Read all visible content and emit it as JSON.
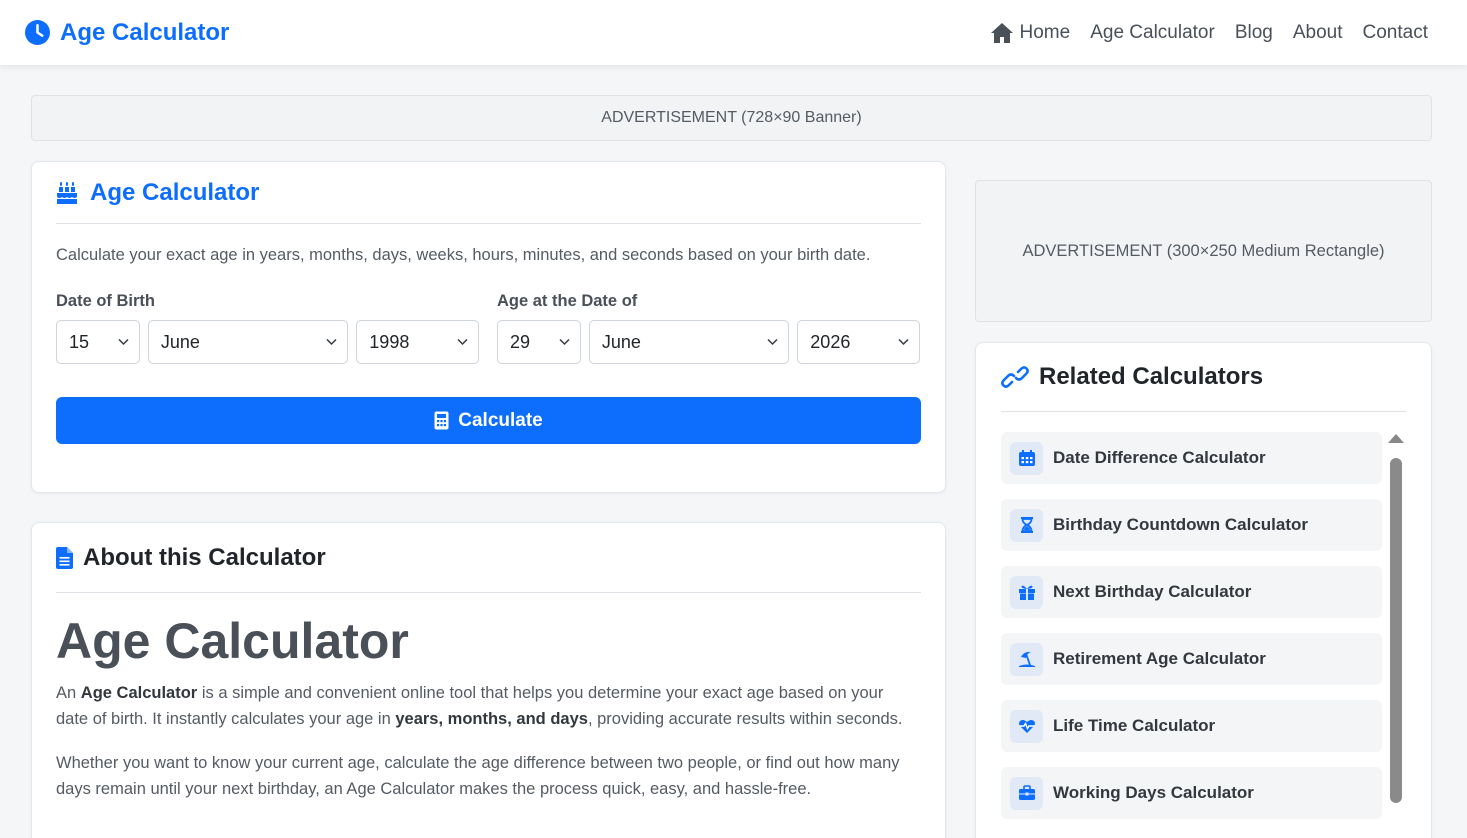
{
  "nav": {
    "brand": "Age Calculator",
    "links": [
      "Home",
      "Age Calculator",
      "Blog",
      "About",
      "Contact"
    ]
  },
  "ads": {
    "banner": "ADVERTISEMENT (728×90 Banner)",
    "rectangle": "ADVERTISEMENT (300×250 Medium Rectangle)"
  },
  "calculator": {
    "title": "Age Calculator",
    "description": "Calculate your exact age in years, months, days, weeks, hours, minutes, and seconds based on your birth date.",
    "dob": {
      "label": "Date of Birth",
      "day": "15",
      "month": "June",
      "year": "1998"
    },
    "target": {
      "label": "Age at the Date of",
      "day": "29",
      "month": "June",
      "year": "2026"
    },
    "button": "Calculate"
  },
  "about": {
    "header": "About this Calculator",
    "title": "Age Calculator",
    "p1": {
      "a": "An ",
      "b": "Age Calculator",
      "c": " is a simple and convenient online tool that helps you determine your exact age based on your date of birth. It instantly calculates your age in ",
      "d": "years, months, and days",
      "e": ", providing accurate results within seconds."
    },
    "p2": "Whether you want to know your current age, calculate the age difference between two people, or find out how many days remain until your next birthday, an Age Calculator makes the process quick, easy, and hassle-free."
  },
  "related": {
    "title": "Related Calculators",
    "items": [
      {
        "label": "Date Difference Calculator",
        "icon": "calendar-icon"
      },
      {
        "label": "Birthday Countdown Calculator",
        "icon": "hourglass-icon"
      },
      {
        "label": "Next Birthday Calculator",
        "icon": "gift-icon"
      },
      {
        "label": "Retirement Age Calculator",
        "icon": "umbrella-beach-icon"
      },
      {
        "label": "Life Time Calculator",
        "icon": "heart-pulse-icon"
      },
      {
        "label": "Working Days Calculator",
        "icon": "briefcase-icon"
      }
    ]
  },
  "colors": {
    "primary": "#0d6efd",
    "text": "#212529",
    "muted": "#555b63"
  }
}
